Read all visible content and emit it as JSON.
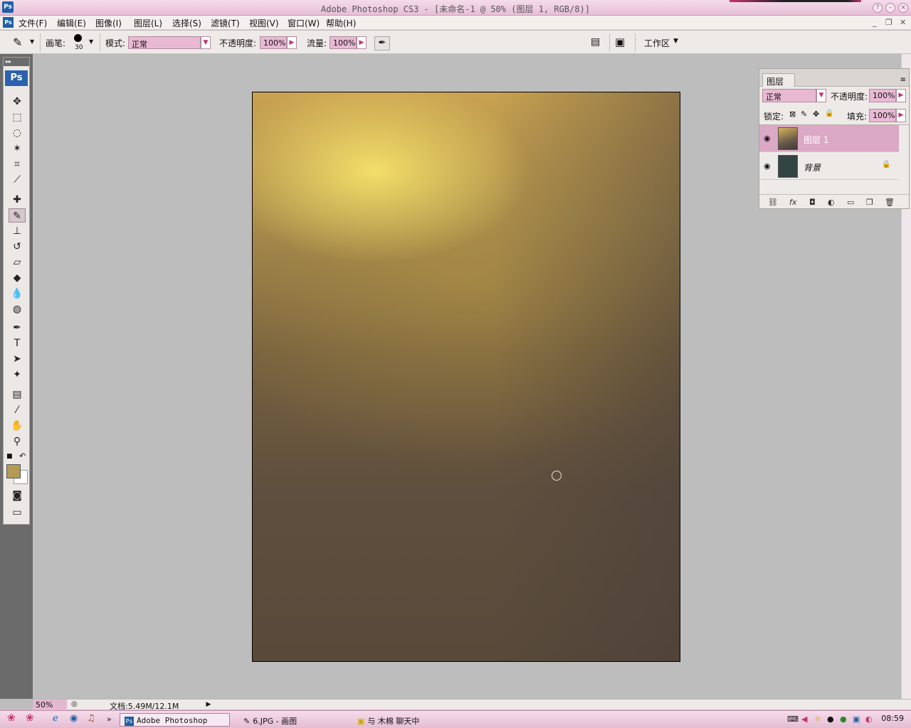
{
  "window": {
    "title": "Adobe Photoshop CS3 - [未命名-1 @ 50% (图层 1, RGB/8)]",
    "app_icon": "Ps"
  },
  "menu": {
    "items": [
      "文件(F)",
      "编辑(E)",
      "图像(I)",
      "图层(L)",
      "选择(S)",
      "滤镜(T)",
      "视图(V)",
      "窗口(W)",
      "帮助(H)"
    ]
  },
  "options": {
    "brush_label": "画笔:",
    "brush_size": "30",
    "mode_label": "模式:",
    "mode_value": "正常",
    "opacity_label": "不透明度:",
    "opacity_value": "100%",
    "flow_label": "流量:",
    "flow_value": "100%",
    "workspace_label": "工作区"
  },
  "toolbox": {
    "logo": "Ps",
    "type_tool": "T",
    "foreground_color": "#b49b52",
    "background_color": "#ffffff"
  },
  "layers_panel": {
    "tab_label": "图层",
    "blend_mode": "正常",
    "opacity_label": "不透明度:",
    "opacity_value": "100%",
    "lock_label": "锁定:",
    "fill_label": "填充:",
    "fill_value": "100%",
    "layers": [
      {
        "name": "图层 1",
        "selected": true
      },
      {
        "name": "背景",
        "selected": false,
        "locked": true
      }
    ]
  },
  "status": {
    "zoom": "50%",
    "doc_info": "文档:5.49M/12.1M"
  },
  "taskbar": {
    "tasks": [
      "Adobe Photoshop ...",
      "6.JPG - 画图",
      "与 木棉 聊天中"
    ],
    "clock": "08:59"
  },
  "colors": {
    "accent": "#e7bfd6",
    "selection": "#dba8c5"
  }
}
